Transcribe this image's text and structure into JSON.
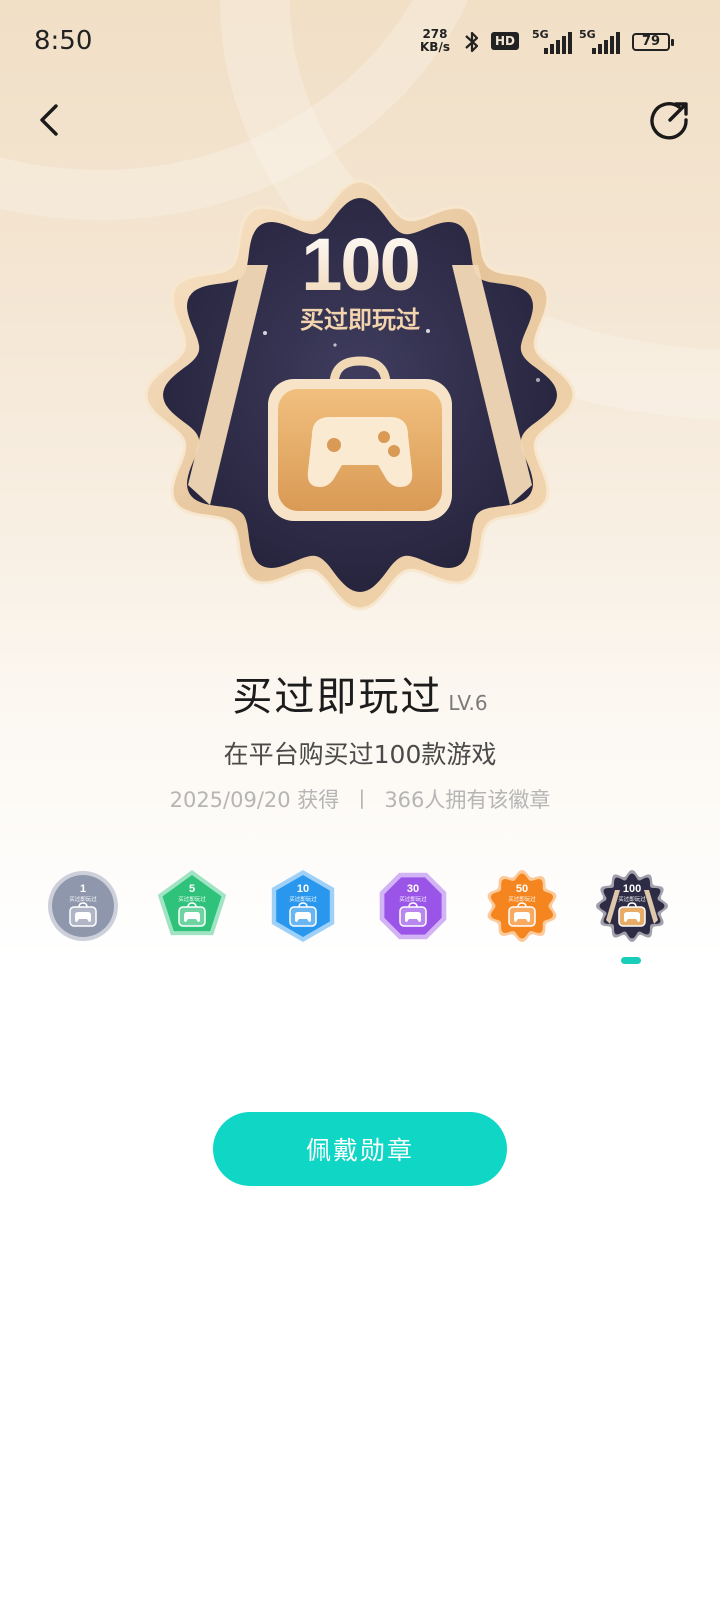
{
  "status_bar": {
    "time": "8:50",
    "net_speed_value": "278",
    "net_speed_unit": "KB/s",
    "hd_label": "HD",
    "sim1_label": "5G",
    "sim2_label": "5G",
    "battery": "79"
  },
  "header": {
    "back_icon": "chevron-left-icon",
    "share_icon": "share-icon"
  },
  "badge": {
    "count": "100",
    "name_on_badge": "买过即玩过",
    "title": "买过即玩过",
    "level": "LV.6",
    "description": "在平台购买过100款游戏",
    "obtained_date": "2025/09/20 获得",
    "separator": "丨",
    "owners": "366人拥有该徽章"
  },
  "levels": [
    {
      "count": "1",
      "label": "买过即玩过",
      "color": "#8f97ad",
      "shape": "circle",
      "selected": false
    },
    {
      "count": "5",
      "label": "买过即玩过",
      "color": "#2fc27a",
      "shape": "pentagon",
      "selected": false
    },
    {
      "count": "10",
      "label": "买过即玩过",
      "color": "#2a97ee",
      "shape": "hexagon",
      "selected": false
    },
    {
      "count": "30",
      "label": "买过即玩过",
      "color": "#9a55e8",
      "shape": "octagon",
      "selected": false
    },
    {
      "count": "50",
      "label": "买过即玩过",
      "color": "#f5861f",
      "shape": "gear",
      "selected": false
    },
    {
      "count": "100",
      "label": "买过即玩过",
      "color": "#2e2c45",
      "shape": "star",
      "selected": true
    }
  ],
  "actions": {
    "wear_button": "佩戴勋章"
  },
  "colors": {
    "accent": "#0fd6c5",
    "badge_dark": "#2e2c45",
    "badge_gold": "#e8c59a"
  }
}
